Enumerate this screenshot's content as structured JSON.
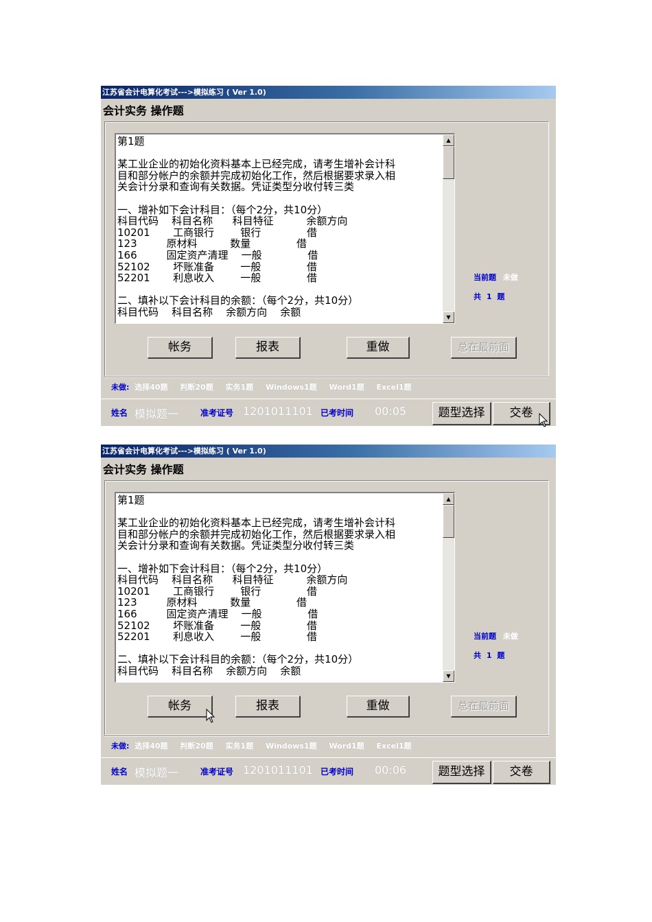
{
  "window_title": "江苏省会计电算化考试--->模拟练习 ( Ver 1.0)",
  "section_heading": "会计实务 操作题",
  "question": {
    "number": "第1题",
    "body": "某工业企业的初始化资料基本上已经完成，请考生增补会计科\n目和部分帐户的余额并完成初始化工作，然后根据要求录入相\n关会计分录和查询有关数据。凭证类型分收付转三类",
    "part1_title": "一、增补如下会计科目：（每个2分，共10分）",
    "part1_header": "科目代码    科目名称      科目特征          余额方向",
    "part1_rows": [
      "10201       工商银行        银行              借",
      "123         原材料          数量              借",
      "166         固定资产清理    一般              借",
      "52102       坏账准备        一般              借",
      "52201       利息收入        一般              借"
    ],
    "part2_title": "二、填补以下会计科目的余额：（每个2分，共10分）",
    "part2_header": "科目代码    科目名称    余额方向    余额"
  },
  "side_status": {
    "current_label": "当前题",
    "current_value": "未做",
    "total_prefix": "共",
    "total_count": "1",
    "total_suffix": "题"
  },
  "buttons": {
    "ledger": "帐务",
    "report": "报表",
    "redo": "重做",
    "always_on_top": "总在最前面",
    "type_select": "题型选择",
    "submit": "交卷"
  },
  "undone_bar": {
    "label": "未做:",
    "items": [
      "选择40题",
      "判断20题",
      "实务1题",
      "Windows1题",
      "Word1题",
      "Excel1题"
    ]
  },
  "footer": {
    "name_label": "姓名",
    "name_value": "模拟题一",
    "id_label": "准考证号",
    "id_value": "1201011101",
    "time_label": "已考时间"
  },
  "screens": [
    {
      "elapsed": "00:05"
    },
    {
      "elapsed": "00:06"
    }
  ],
  "icons": {
    "scroll_up": "scroll-up-arrow-icon",
    "scroll_down": "scroll-down-arrow-icon",
    "cursor": "mouse-pointer-icon"
  }
}
